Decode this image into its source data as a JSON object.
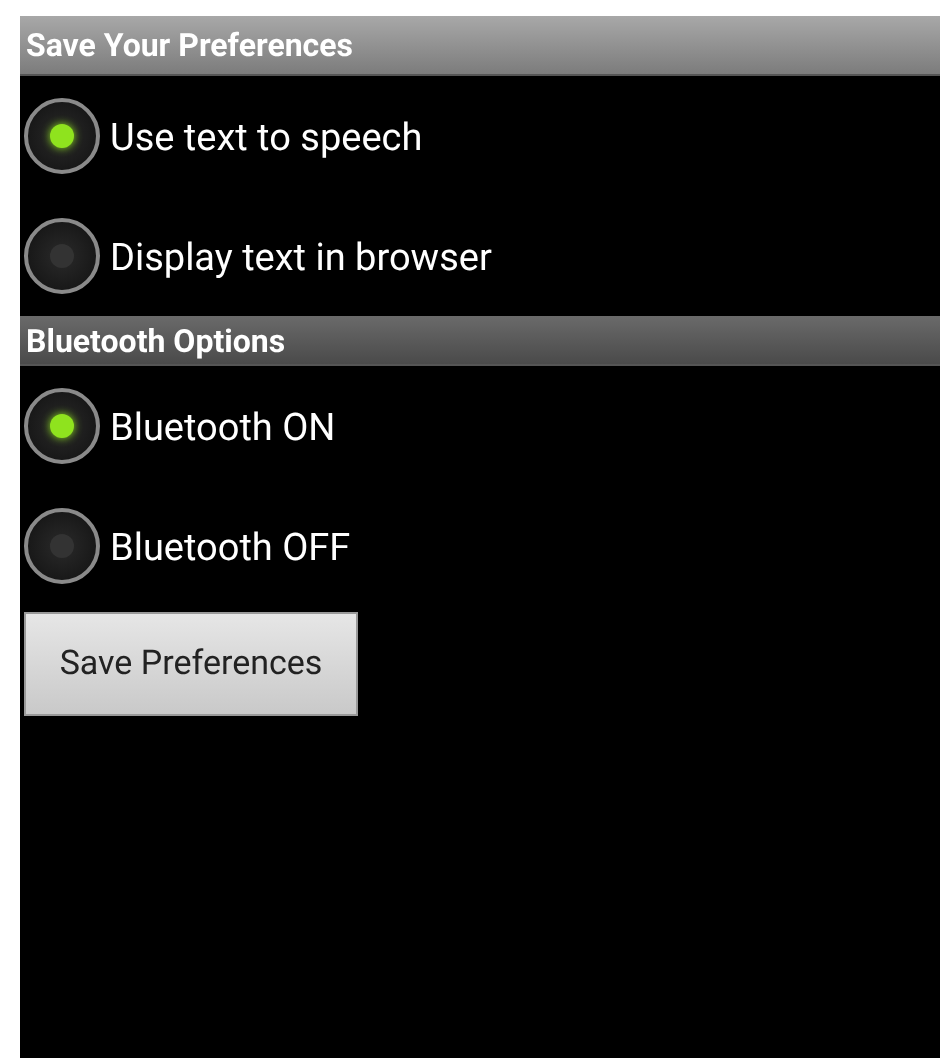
{
  "sections": [
    {
      "title": "Save Your Preferences",
      "options": [
        {
          "label": "Use text to speech",
          "selected": true
        },
        {
          "label": "Display text in browser",
          "selected": false
        }
      ]
    },
    {
      "title": "Bluetooth Options",
      "options": [
        {
          "label": "Bluetooth ON",
          "selected": true
        },
        {
          "label": "Bluetooth OFF",
          "selected": false
        }
      ]
    }
  ],
  "button": {
    "label": "Save Preferences"
  }
}
